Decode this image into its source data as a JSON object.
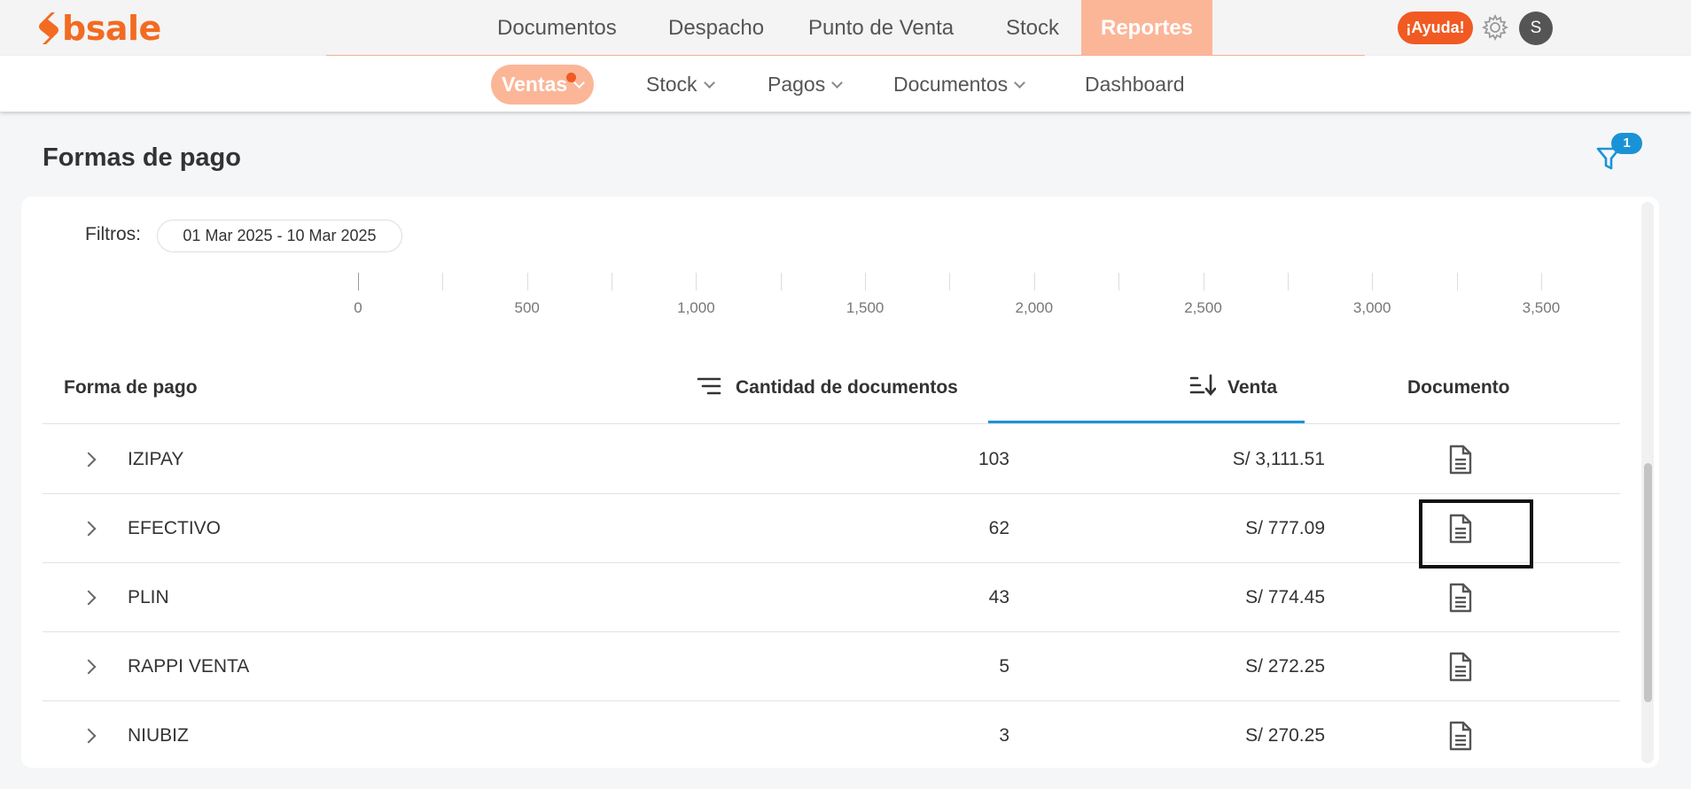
{
  "brand": {
    "name": "bsale",
    "color": "#f26b21"
  },
  "top_nav": {
    "items": [
      {
        "label": "Documentos",
        "active": false
      },
      {
        "label": "Despacho",
        "active": false
      },
      {
        "label": "Punto de Venta",
        "active": false
      },
      {
        "label": "Stock",
        "active": false
      },
      {
        "label": "Reportes",
        "active": true
      }
    ],
    "help_label": "¡Ayuda!",
    "settings_icon": "gear-icon",
    "avatar_initial": "S"
  },
  "sub_nav": {
    "items": [
      {
        "label": "Ventas",
        "active": true,
        "has_dropdown": true,
        "has_notification": true
      },
      {
        "label": "Stock",
        "active": false,
        "has_dropdown": true
      },
      {
        "label": "Pagos",
        "active": false,
        "has_dropdown": true
      },
      {
        "label": "Documentos",
        "active": false,
        "has_dropdown": true
      },
      {
        "label": "Dashboard",
        "active": false,
        "has_dropdown": false
      }
    ]
  },
  "page": {
    "title": "Formas de pago",
    "filter_badge_count": "1",
    "filters_label": "Filtros:",
    "date_range": "01 Mar 2025 - 10 Mar 2025"
  },
  "axis": {
    "labels": [
      "0",
      "500",
      "1,000",
      "1,500",
      "2,000",
      "2,500",
      "3,000",
      "3,500"
    ]
  },
  "table": {
    "columns": {
      "payment_method": "Forma de pago",
      "doc_count": "Cantidad de documentos",
      "sale": "Venta",
      "document": "Documento"
    },
    "rows": [
      {
        "name": "IZIPAY",
        "count": "103",
        "sale": "S/ 3,111.51"
      },
      {
        "name": "EFECTIVO",
        "count": "62",
        "sale": "S/ 777.09"
      },
      {
        "name": "PLIN",
        "count": "43",
        "sale": "S/ 774.45"
      },
      {
        "name": "RAPPI VENTA",
        "count": "5",
        "sale": "S/ 272.25"
      },
      {
        "name": "NIUBIZ",
        "count": "3",
        "sale": "S/ 270.25"
      }
    ]
  },
  "colors": {
    "accent_light": "#fbb698",
    "accent": "#f15a22",
    "link_blue": "#1a93d6"
  }
}
